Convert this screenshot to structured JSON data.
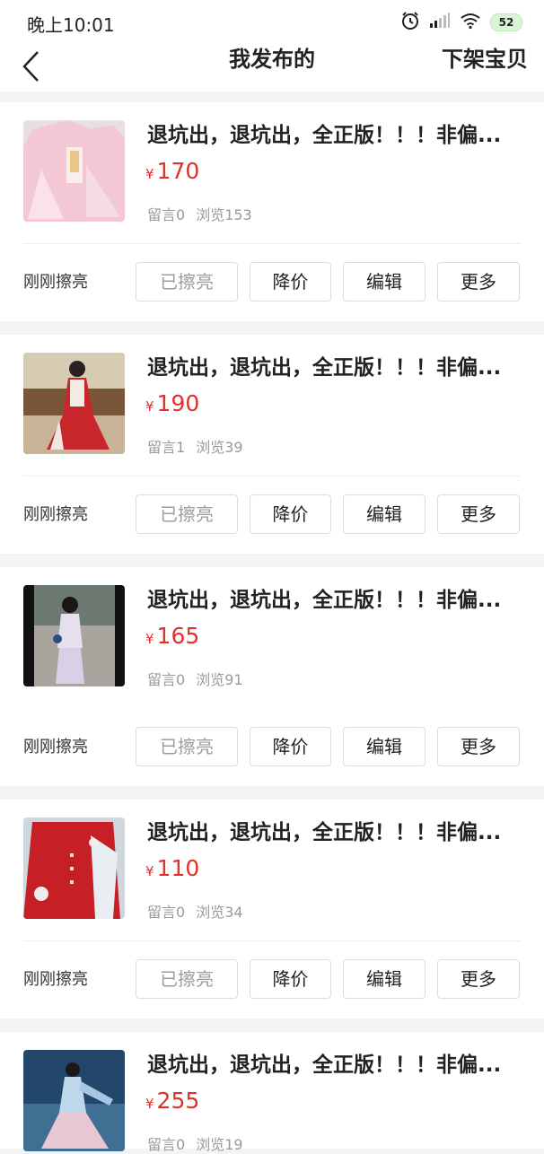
{
  "status_bar": {
    "time": "晚上10:01",
    "battery": "52",
    "icons": [
      "alarm-icon",
      "signal-icon",
      "wifi-icon",
      "battery-icon"
    ]
  },
  "header": {
    "back_icon": "chevron-left-icon",
    "title": "我发布的",
    "right_action": "下架宝贝"
  },
  "colors": {
    "price": "#e0312a",
    "background": "#f4f4f6",
    "card": "#ffffff"
  },
  "items": [
    {
      "title": "退坑出，退坑出，全正版！！！非偏...",
      "currency": "¥",
      "price": "170",
      "comments": "留言0",
      "views": "浏览153",
      "refresh_status": "刚刚擦亮",
      "actions": {
        "refreshed": "已擦亮",
        "reduce": "降价",
        "edit": "编辑",
        "more": "更多"
      }
    },
    {
      "title": "退坑出，退坑出，全正版！！！非偏...",
      "currency": "¥",
      "price": "190",
      "comments": "留言1",
      "views": "浏览39",
      "refresh_status": "刚刚擦亮",
      "actions": {
        "refreshed": "已擦亮",
        "reduce": "降价",
        "edit": "编辑",
        "more": "更多"
      }
    },
    {
      "title": "退坑出，退坑出，全正版！！！非偏...",
      "currency": "¥",
      "price": "165",
      "comments": "留言0",
      "views": "浏览91",
      "refresh_status": "刚刚擦亮",
      "actions": {
        "refreshed": "已擦亮",
        "reduce": "降价",
        "edit": "编辑",
        "more": "更多"
      }
    },
    {
      "title": "退坑出，退坑出，全正版！！！非偏...",
      "currency": "¥",
      "price": "110",
      "comments": "留言0",
      "views": "浏览34",
      "refresh_status": "刚刚擦亮",
      "actions": {
        "refreshed": "已擦亮",
        "reduce": "降价",
        "edit": "编辑",
        "more": "更多"
      }
    },
    {
      "title": "退坑出，退坑出，全正版！！！非偏...",
      "currency": "¥",
      "price": "255",
      "comments": "留言0",
      "views": "浏览19",
      "refresh_status": "",
      "actions": {
        "refreshed": "",
        "reduce": "",
        "edit": "",
        "more": ""
      }
    }
  ]
}
